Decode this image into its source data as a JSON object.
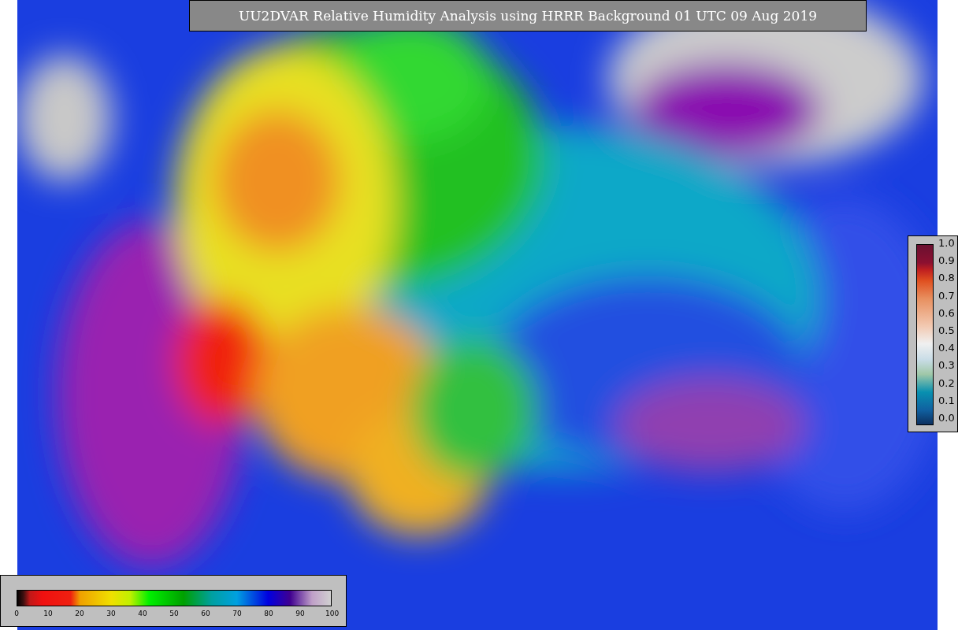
{
  "title": "UU2DVAR Relative Humidity Analysis using HRRR Background 01 UTC 09 Aug 2019",
  "humidity_colorbar": {
    "ticks": [
      "0",
      "10",
      "20",
      "30",
      "40",
      "50",
      "60",
      "70",
      "80",
      "90",
      "100"
    ]
  },
  "error_colorbar": {
    "ticks": [
      "1.0",
      "0.9",
      "0.8",
      "0.7",
      "0.6",
      "0.5",
      "0.4",
      "0.3",
      "0.2",
      "0.1",
      "0.0"
    ]
  }
}
